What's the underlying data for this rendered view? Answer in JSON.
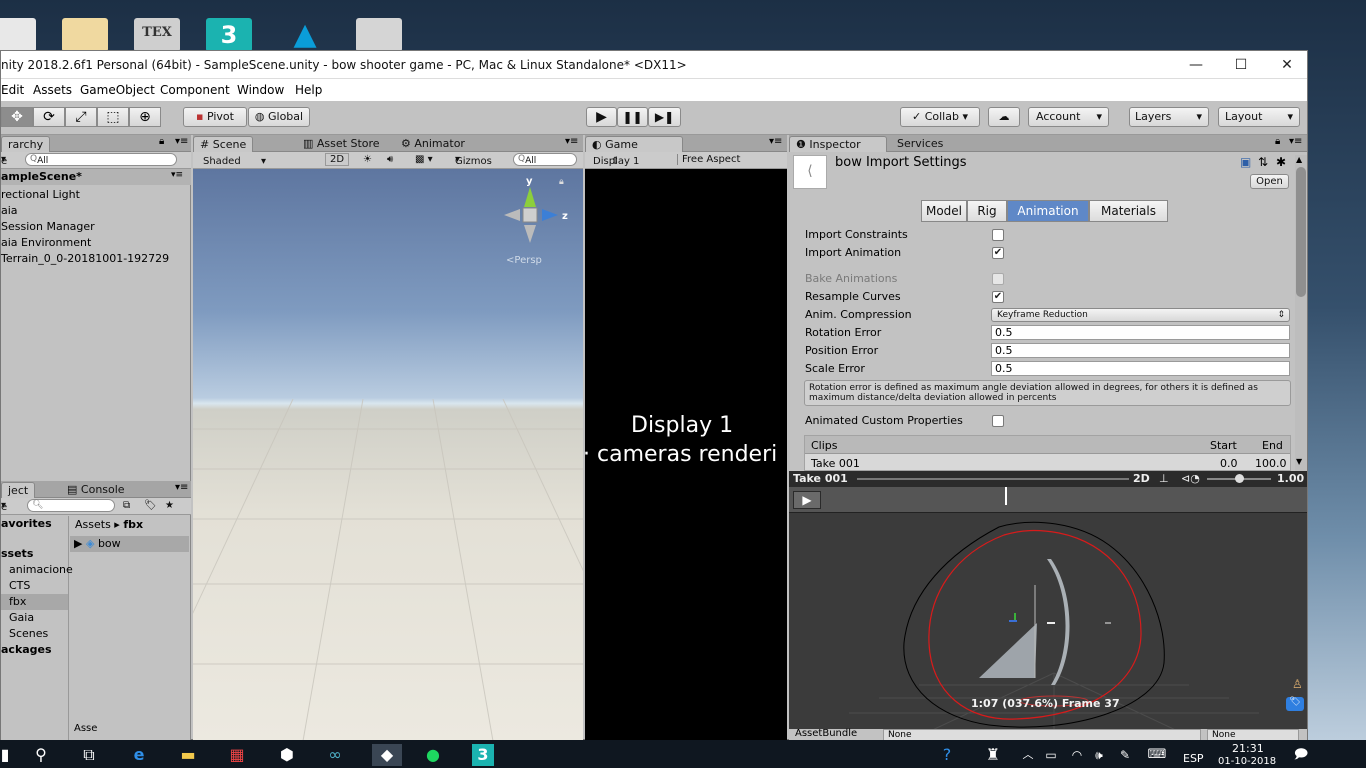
{
  "window": {
    "title": "nity 2018.2.6f1 Personal (64bit) - SampleScene.unity - bow shooter game - PC, Mac & Linux Standalone* <DX11>"
  },
  "menu": [
    "Edit",
    "Assets",
    "GameObject",
    "Component",
    "Window",
    "Help"
  ],
  "toolbar": {
    "pivot": "Pivot",
    "global": "Global",
    "collab": "Collab",
    "account": "Account",
    "layers": "Layers",
    "layout": "Layout"
  },
  "hierarchy": {
    "tab": "rarchy",
    "create": "e",
    "search_placeholder": "All",
    "scene": "ampleScene*",
    "items": [
      "rectional Light",
      "aia",
      "Session Manager",
      "aia Environment",
      "Terrain_0_0-20181001-192729"
    ]
  },
  "scene_view": {
    "tabs": [
      "Scene",
      "Asset Store",
      "Animator"
    ],
    "shading": "Shaded",
    "mode_2d": "2D",
    "gizmos": "Gizmos",
    "search_placeholder": "All",
    "gizmo_axes": {
      "y": "y",
      "z": "z"
    },
    "persp": "Persp"
  },
  "game_view": {
    "tab": "Game",
    "display": "Display 1",
    "aspect": "Free Aspect",
    "message_line1": "Display 1",
    "message_line2": "cameras renderi"
  },
  "project": {
    "tabs": [
      "ject",
      "Console"
    ],
    "create": "e",
    "favorites": "avorites",
    "assets_header": "ssets",
    "folders": [
      "animacione",
      "CTS",
      "fbx",
      "Gaia",
      "Scenes"
    ],
    "packages": "ackages",
    "breadcrumb_root": "Assets",
    "breadcrumb_current": "fbx",
    "asset": "bow",
    "bottom_label": "Asse"
  },
  "inspector": {
    "tabs": [
      "Inspector",
      "Services"
    ],
    "title": "bow Import Settings",
    "open_button": "Open",
    "segments": [
      "Model",
      "Rig",
      "Animation",
      "Materials"
    ],
    "active_segment": "Animation",
    "import_constraints": "Import Constraints",
    "import_animation": "Import Animation",
    "bake_animations": "Bake Animations",
    "resample_curves": "Resample Curves",
    "anim_compression": "Anim. Compression",
    "compression_value": "Keyframe Reduction",
    "rotation_error": "Rotation Error",
    "rotation_value": "0.5",
    "position_error": "Position Error",
    "position_value": "0.5",
    "scale_error": "Scale Error",
    "scale_value": "0.5",
    "help_text": "Rotation error is defined as maximum angle deviation allowed in degrees, for others it is defined as maximum distance/delta deviation allowed in percents",
    "animated_custom": "Animated Custom Properties",
    "clips_header": "Clips",
    "start_header": "Start",
    "end_header": "End",
    "clip_name": "Take 001",
    "clip_start": "0.0",
    "clip_end": "100.0"
  },
  "preview": {
    "title": "Take 001",
    "mode_2d": "2D",
    "speed": "1.00",
    "frame_text": "1:07 (037.6%) Frame 37",
    "asset_bundle": "AssetBundle",
    "bundle_value": "None",
    "variant_value": "None"
  },
  "taskbar": {
    "language": "ESP",
    "time": "21:31",
    "date": "01-10-2018"
  },
  "colors": {
    "unity_gray": "#c2c2c2",
    "selection_blue": "#5f88c7",
    "scene_sky": "#6d86ad",
    "preview_bg": "#3b3b3b",
    "red_annotation": "#d81b1b"
  }
}
